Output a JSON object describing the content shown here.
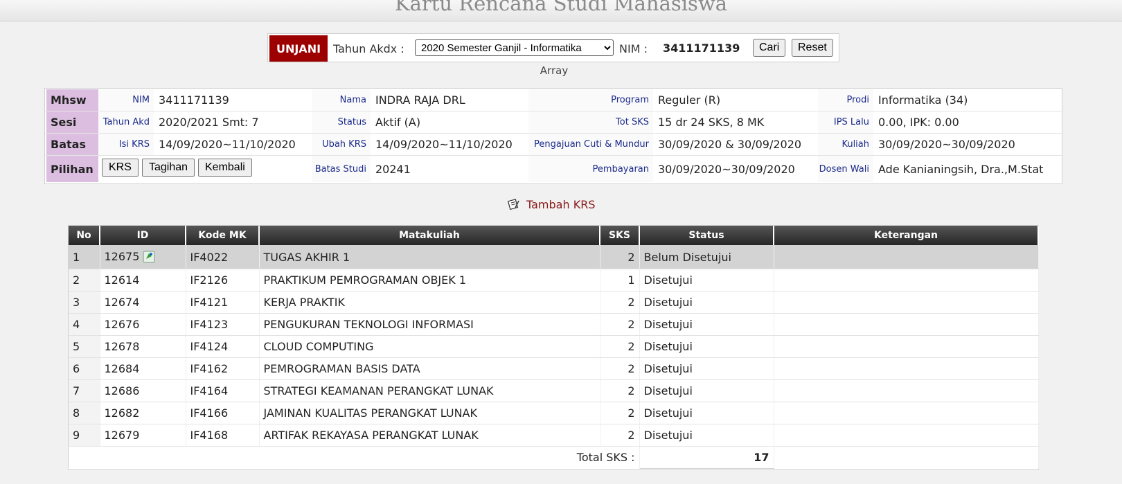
{
  "page": {
    "title": "Kartu Rencana Studi Mahasiswa"
  },
  "search": {
    "brand": "UNJANI",
    "year_label": "Tahun Akdx :",
    "year_selected": "2020 Semester Ganjil - Informatika",
    "nim_label": "NIM :",
    "nim_value": "3411171139",
    "search_button": "Cari",
    "reset_button": "Reset"
  },
  "array_text": "Array",
  "info": {
    "rows": [
      {
        "head": "Mhsw",
        "cells": [
          {
            "label": "NIM",
            "value": "3411171139"
          },
          {
            "label": "Nama",
            "value": "INDRA RAJA DRL"
          },
          {
            "label": "Program",
            "value": "Reguler (R)"
          },
          {
            "label": "Prodi",
            "value": "Informatika (34)"
          }
        ]
      },
      {
        "head": "Sesi",
        "cells": [
          {
            "label": "Tahun Akd",
            "value": "2020/2021 Smt: 7"
          },
          {
            "label": "Status",
            "value": "Aktif (A)"
          },
          {
            "label": "Tot SKS",
            "value": "15 dr 24 SKS, 8 MK"
          },
          {
            "label": "IPS Lalu",
            "value": "0.00, IPK: 0.00"
          }
        ]
      },
      {
        "head": "Batas",
        "cells": [
          {
            "label": "Isi KRS",
            "value": "14/09/2020~11/10/2020"
          },
          {
            "label": "Ubah KRS",
            "value": "14/09/2020~11/10/2020"
          },
          {
            "label": "Pengajuan Cuti & Mundur",
            "value": "30/09/2020 & 30/09/2020"
          },
          {
            "label": "Kuliah",
            "value": "30/09/2020~30/09/2020"
          }
        ]
      },
      {
        "head": "Pilihan",
        "buttons": [
          "KRS",
          "Tagihan",
          "Kembali"
        ],
        "cells": [
          {
            "label": "Batas Studi",
            "value": "20241"
          },
          {
            "label": "Pembayaran",
            "value": "30/09/2020~30/09/2020"
          },
          {
            "label": "Dosen Wali",
            "value": "Ade Kanianingsih, Dra.,M.Stat"
          }
        ]
      }
    ]
  },
  "tambah": {
    "label": "Tambah KRS",
    "icon": "edit-note-icon"
  },
  "krs": {
    "headers": [
      "No",
      "ID",
      "Kode MK",
      "Matakuliah",
      "SKS",
      "Status",
      "Keterangan"
    ],
    "rows": [
      {
        "no": "1",
        "id": "12675",
        "kode": "IF4022",
        "mk": "TUGAS AKHIR 1",
        "sks": "2",
        "status": "Belum Disetujui",
        "ket": "",
        "highlight": true,
        "icon": "edit-icon"
      },
      {
        "no": "2",
        "id": "12614",
        "kode": "IF2126",
        "mk": "PRAKTIKUM PEMROGRAMAN OBJEK 1",
        "sks": "1",
        "status": "Disetujui",
        "ket": ""
      },
      {
        "no": "3",
        "id": "12674",
        "kode": "IF4121",
        "mk": "KERJA PRAKTIK",
        "sks": "2",
        "status": "Disetujui",
        "ket": ""
      },
      {
        "no": "4",
        "id": "12676",
        "kode": "IF4123",
        "mk": "PENGUKURAN TEKNOLOGI INFORMASI",
        "sks": "2",
        "status": "Disetujui",
        "ket": ""
      },
      {
        "no": "5",
        "id": "12678",
        "kode": "IF4124",
        "mk": "CLOUD COMPUTING",
        "sks": "2",
        "status": "Disetujui",
        "ket": ""
      },
      {
        "no": "6",
        "id": "12684",
        "kode": "IF4162",
        "mk": "PEMROGRAMAN BASIS DATA",
        "sks": "2",
        "status": "Disetujui",
        "ket": ""
      },
      {
        "no": "7",
        "id": "12686",
        "kode": "IF4164",
        "mk": "STRATEGI KEAMANAN PERANGKAT LUNAK",
        "sks": "2",
        "status": "Disetujui",
        "ket": ""
      },
      {
        "no": "8",
        "id": "12682",
        "kode": "IF4166",
        "mk": "JAMINAN KUALITAS PERANGKAT LUNAK",
        "sks": "2",
        "status": "Disetujui",
        "ket": ""
      },
      {
        "no": "9",
        "id": "12679",
        "kode": "IF4168",
        "mk": "ARTIFAK REKAYASA PERANGKAT LUNAK",
        "sks": "2",
        "status": "Disetujui",
        "ket": ""
      }
    ],
    "total_label": "Total SKS :",
    "total_value": "17"
  },
  "colors": {
    "brand": "#9c0000",
    "info_head": "#dcbfe0",
    "label_text": "#1a2a8a",
    "link": "#8a1a1a"
  }
}
